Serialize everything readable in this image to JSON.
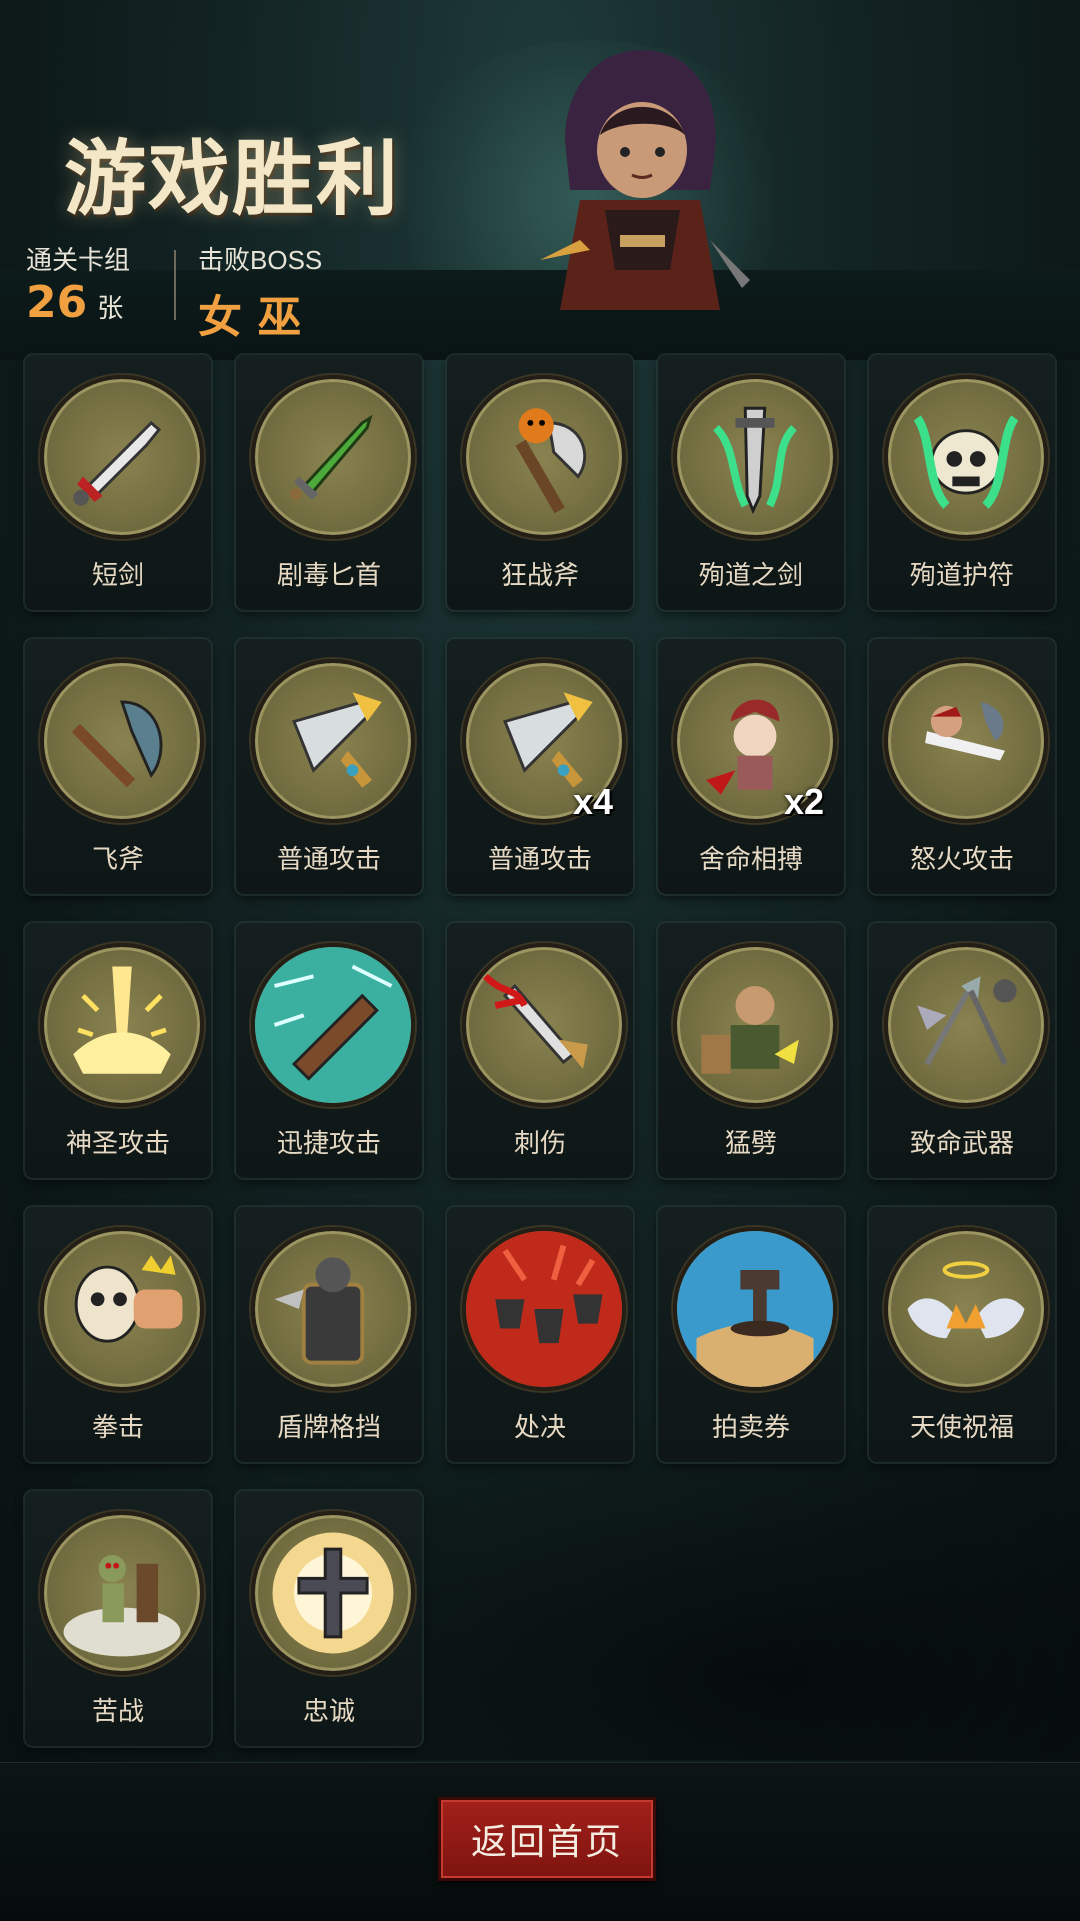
{
  "header": {
    "title": "游戏胜利",
    "cleared_label": "通关卡组",
    "cleared_count": "26",
    "cleared_unit": "张",
    "boss_label": "击败BOSS",
    "boss_name": "女 巫"
  },
  "cards": [
    {
      "name": "短剑",
      "icon": "short-sword-icon"
    },
    {
      "name": "剧毒匕首",
      "icon": "poison-dagger-icon"
    },
    {
      "name": "狂战斧",
      "icon": "berserker-axe-icon"
    },
    {
      "name": "殉道之剑",
      "icon": "martyr-sword-icon"
    },
    {
      "name": "殉道护符",
      "icon": "martyr-amulet-icon"
    },
    {
      "name": "飞斧",
      "icon": "throwing-axe-icon"
    },
    {
      "name": "普通攻击",
      "icon": "basic-attack-icon"
    },
    {
      "name": "普通攻击",
      "icon": "basic-attack-icon",
      "badge": "x4"
    },
    {
      "name": "舍命相搏",
      "icon": "desperate-fight-icon",
      "badge": "x2"
    },
    {
      "name": "怒火攻击",
      "icon": "rage-attack-icon"
    },
    {
      "name": "神圣攻击",
      "icon": "holy-attack-icon"
    },
    {
      "name": "迅捷攻击",
      "icon": "swift-attack-icon"
    },
    {
      "name": "刺伤",
      "icon": "stab-icon"
    },
    {
      "name": "猛劈",
      "icon": "cleave-icon"
    },
    {
      "name": "致命武器",
      "icon": "deadly-weapons-icon"
    },
    {
      "name": "拳击",
      "icon": "punch-icon"
    },
    {
      "name": "盾牌格挡",
      "icon": "shield-block-icon"
    },
    {
      "name": "处决",
      "icon": "execute-icon"
    },
    {
      "name": "拍卖券",
      "icon": "auction-ticket-icon"
    },
    {
      "name": "天使祝福",
      "icon": "angel-blessing-icon"
    },
    {
      "name": "苦战",
      "icon": "hard-fight-icon"
    },
    {
      "name": "忠诚",
      "icon": "loyalty-icon"
    }
  ],
  "footer": {
    "home_button": "返回首页"
  }
}
